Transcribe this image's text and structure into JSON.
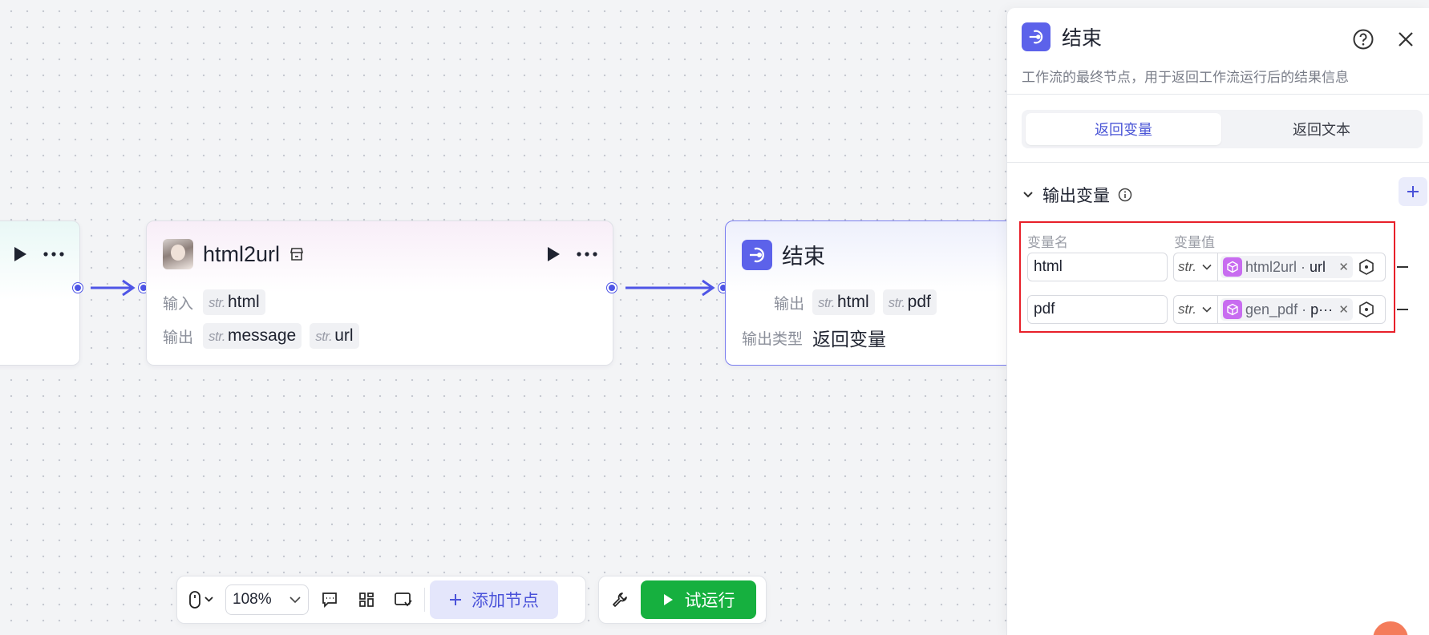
{
  "canvas": {
    "nodes": {
      "html2url": {
        "title": "html2url",
        "input_label": "输入",
        "output_label": "输出",
        "inputs": [
          {
            "type": "str.",
            "name": "html"
          }
        ],
        "outputs": [
          {
            "type": "str.",
            "name": "message"
          },
          {
            "type": "str.",
            "name": "url"
          }
        ]
      },
      "end": {
        "title": "结束",
        "output_label": "输出",
        "outputs": [
          {
            "type": "str.",
            "name": "html"
          },
          {
            "type": "str.",
            "name": "pdf"
          }
        ],
        "output_type_label": "输出类型",
        "output_type_value": "返回变量"
      }
    }
  },
  "panel": {
    "title": "结束",
    "description": "工作流的最终节点，用于返回工作流运行后的结果信息",
    "tabs": [
      {
        "label": "返回变量",
        "active": true
      },
      {
        "label": "返回文本",
        "active": false
      }
    ],
    "section_title": "输出变量",
    "col_name": "变量名",
    "col_value": "变量值",
    "variables": [
      {
        "name": "html",
        "type": "str.",
        "ref_node": "html2url",
        "ref_sep": " · ",
        "ref_field": "url"
      },
      {
        "name": "pdf",
        "type": "str.",
        "ref_node": "gen_pdf",
        "ref_sep": " · ",
        "ref_field": "p···"
      }
    ]
  },
  "toolbar": {
    "zoom": "108%",
    "add_node": "添加节点",
    "run": "试运行"
  },
  "colors": {
    "accent": "#4e55e6",
    "run_green": "#16b03f",
    "highlight_red": "#e8202a"
  }
}
